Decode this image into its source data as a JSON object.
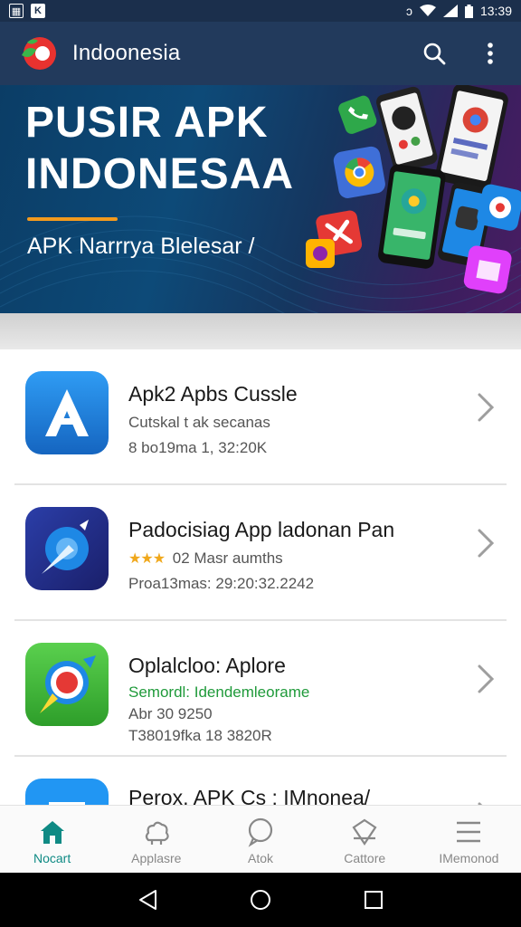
{
  "status_bar": {
    "time": "13:39",
    "left_icons": [
      "image-icon",
      "k-app-icon"
    ],
    "right_icons": [
      "vibrate-icon",
      "wifi-icon",
      "signal-icon",
      "battery-icon"
    ]
  },
  "app_bar": {
    "title": "Indoonesia",
    "actions": [
      "search-icon",
      "more-vert-icon"
    ]
  },
  "hero": {
    "title_line1": "PUSIR APK",
    "title_line2": "INDONESAA",
    "subtitle": "APK Narrrya Blelesar /"
  },
  "apps": [
    {
      "name": "Apk2 Apbs Cussle",
      "line1": "Cutskal t ak secanas",
      "line2": "8 bo19ma 1, 32:20K",
      "icon": "letter-a-icon",
      "icon_color": "#1e88e5"
    },
    {
      "name": "Padocisiag App ladonan Pan",
      "stars": "★★★",
      "line1": "02 Masr aumths",
      "line2": "Proa13mas: 29:20:32.2242",
      "icon": "comet-icon",
      "icon_color": "#2a2f8a"
    },
    {
      "name": "Oplalcloo: Aplore",
      "line1": "Semordl: Idendemleorame",
      "line2": "Abr 30 9250",
      "line3": "T38019fka 18 3820R",
      "icon": "target-icon",
      "icon_color": "#4cc542"
    },
    {
      "name": "Perox, APK Cs : IMnonea/",
      "icon": "app-icon-partial",
      "icon_color": "#2196f3"
    }
  ],
  "bottom_nav": [
    {
      "label": "Nocart",
      "icon": "home-icon",
      "active": true
    },
    {
      "label": "Applasre",
      "icon": "apps-icon",
      "active": false
    },
    {
      "label": "Atok",
      "icon": "chat-bubble-icon",
      "active": false
    },
    {
      "label": "Cattore",
      "icon": "shield-icon",
      "active": false
    },
    {
      "label": "IMemonod",
      "icon": "menu-icon",
      "active": false
    }
  ],
  "colors": {
    "app_bar": "#223a5c",
    "accent": "#0f8a84",
    "hero_underline": "#f39a1e"
  }
}
